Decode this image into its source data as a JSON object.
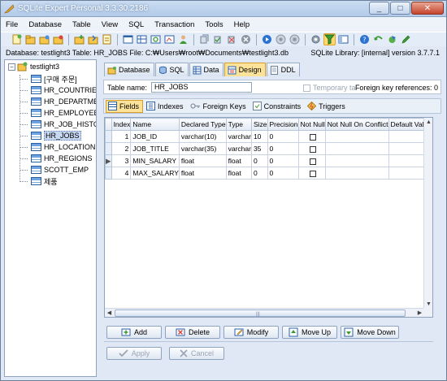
{
  "window": {
    "title": "SQLite Expert Personal 3.3.30.2186",
    "buttons": [
      "_",
      "□",
      "✕"
    ]
  },
  "menu": [
    "File",
    "Database",
    "Table",
    "View",
    "SQL",
    "Transaction",
    "Tools",
    "Help"
  ],
  "pathbar": {
    "left": "Database: testlight3   Table: HR_JOBS   File: C:₩Users₩root₩Documents₩testlight3.db",
    "right": "SQLite Library: [internal] version 3.7.7.1"
  },
  "tree": {
    "root": "testlight3",
    "expander": "−",
    "items": [
      "[구매 주문]",
      "HR_COUNTRIES",
      "HR_DEPARTMENTS",
      "HR_EMPLOYEES",
      "HR_JOB_HISTORY",
      "HR_JOBS",
      "HR_LOCATIONS",
      "HR_REGIONS",
      "SCOTT_EMP",
      "제품"
    ],
    "selected": "HR_JOBS"
  },
  "top_tabs": [
    "Database",
    "SQL",
    "Data",
    "Design",
    "DDL"
  ],
  "active_top_tab": "Design",
  "table_name": {
    "label": "Table name:",
    "value": "HR_JOBS"
  },
  "temporary_table": "Temporary table",
  "foreign_key_refs": "Foreign key references: 0",
  "design_tabs": [
    "Fields",
    "Indexes",
    "Foreign Keys",
    "Constraints",
    "Triggers"
  ],
  "active_design_tab": "Fields",
  "grid": {
    "columns": [
      "Index",
      "Name",
      "Declared Type",
      "Type",
      "Size",
      "Precision",
      "Not Null",
      "Not Null On Conflict",
      "Default Value"
    ],
    "rows": [
      {
        "index": "1",
        "name": "JOB_ID",
        "declared": "varchar(10)",
        "type": "varchar",
        "size": "10",
        "precision": "0",
        "indicator": ""
      },
      {
        "index": "2",
        "name": "JOB_TITLE",
        "declared": "varchar(35)",
        "type": "varchar",
        "size": "35",
        "precision": "0",
        "indicator": ""
      },
      {
        "index": "3",
        "name": "MIN_SALARY",
        "declared": "float",
        "type": "float",
        "size": "0",
        "precision": "0",
        "indicator": "▶"
      },
      {
        "index": "4",
        "name": "MAX_SALARY",
        "declared": "float",
        "type": "float",
        "size": "0",
        "precision": "0",
        "indicator": ""
      }
    ],
    "scroll_grip": "|||"
  },
  "buttons": {
    "add": "Add",
    "delete": "Delete",
    "modify": "Modify",
    "move_up": "Move Up",
    "move_down": "Move Down",
    "apply": "Apply",
    "cancel": "Cancel"
  },
  "colors": {
    "accent_active_tab": "#fde39a",
    "selection": "#c6d8f2",
    "frame": "#dfe8f4"
  }
}
